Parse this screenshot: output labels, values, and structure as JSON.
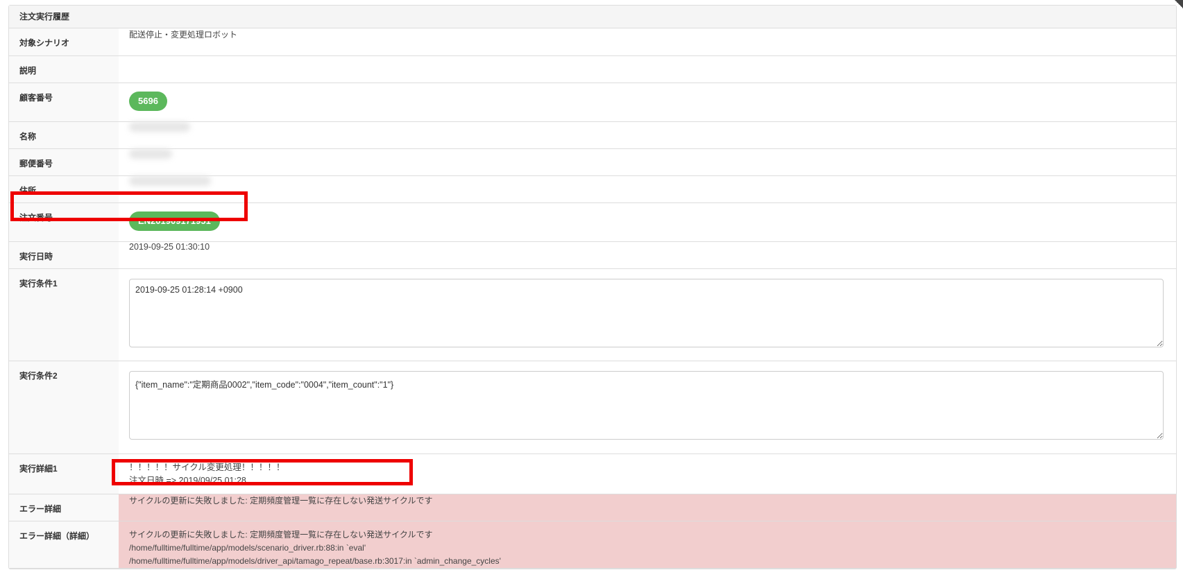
{
  "panel_title": "注文実行履歴",
  "rows": {
    "scenario": {
      "label": "対象シナリオ",
      "value": "配送停止・変更処理ロボット"
    },
    "description": {
      "label": "説明",
      "value": ""
    },
    "customer_number": {
      "label": "顧客番号",
      "value": "5696"
    },
    "name": {
      "label": "名称"
    },
    "postal_code": {
      "label": "郵便番号"
    },
    "address": {
      "label": "住所"
    },
    "order_number": {
      "label": "注文番号",
      "value": "EN201909171951"
    },
    "executed_at": {
      "label": "実行日時",
      "value": "2019-09-25 01:30:10"
    },
    "condition1": {
      "label": "実行条件1",
      "value": "2019-09-25 01:28:14 +0900"
    },
    "condition2": {
      "label": "実行条件2",
      "value": "{\"item_name\":\"定期商品0002\",\"item_code\":\"0004\",\"item_count\":\"1\"}"
    },
    "detail1": {
      "label": "実行詳細1",
      "line1": "！！！！！サイクル変更処理！！！！！",
      "line2": "注文日時 => 2019/09/25 01:28"
    },
    "error": {
      "label": "エラー詳細",
      "value": "サイクルの更新に失敗しました: 定期頻度管理一覧に存在しない発送サイクルです"
    },
    "error_detail": {
      "label": "エラー詳細（詳細）",
      "line1": "サイクルの更新に失敗しました: 定期頻度管理一覧に存在しない発送サイクルです",
      "line2": "/home/fulltime/fulltime/app/models/scenario_driver.rb:88:in `eval'",
      "line3": "/home/fulltime/fulltime/app/models/driver_api/tamago_repeat/base.rb:3017:in `admin_change_cycles'"
    }
  },
  "colors": {
    "badge": "#5cb85c",
    "error_background": "#f2cece",
    "annotation": "#ee0000"
  }
}
